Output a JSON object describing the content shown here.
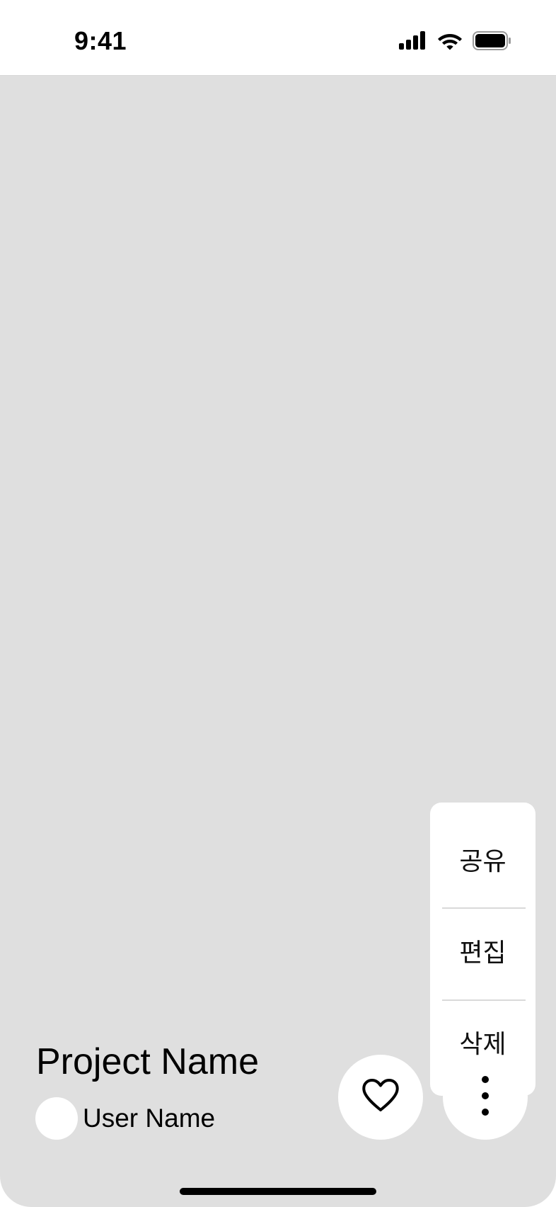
{
  "status_bar": {
    "time": "9:41",
    "icons": [
      "cellular-signal-icon",
      "wifi-icon",
      "battery-icon"
    ]
  },
  "colors": {
    "background": "#dfdfdf",
    "surface": "#ffffff",
    "text": "#000000",
    "divider": "#d9d9d9"
  },
  "menu": {
    "items": [
      {
        "label": "공유"
      },
      {
        "label": "편집"
      },
      {
        "label": "삭제"
      }
    ]
  },
  "project": {
    "name": "Project Name",
    "user_name": "User Name"
  },
  "actions": {
    "like_icon": "heart-icon",
    "more_icon": "more-vertical-icon"
  }
}
